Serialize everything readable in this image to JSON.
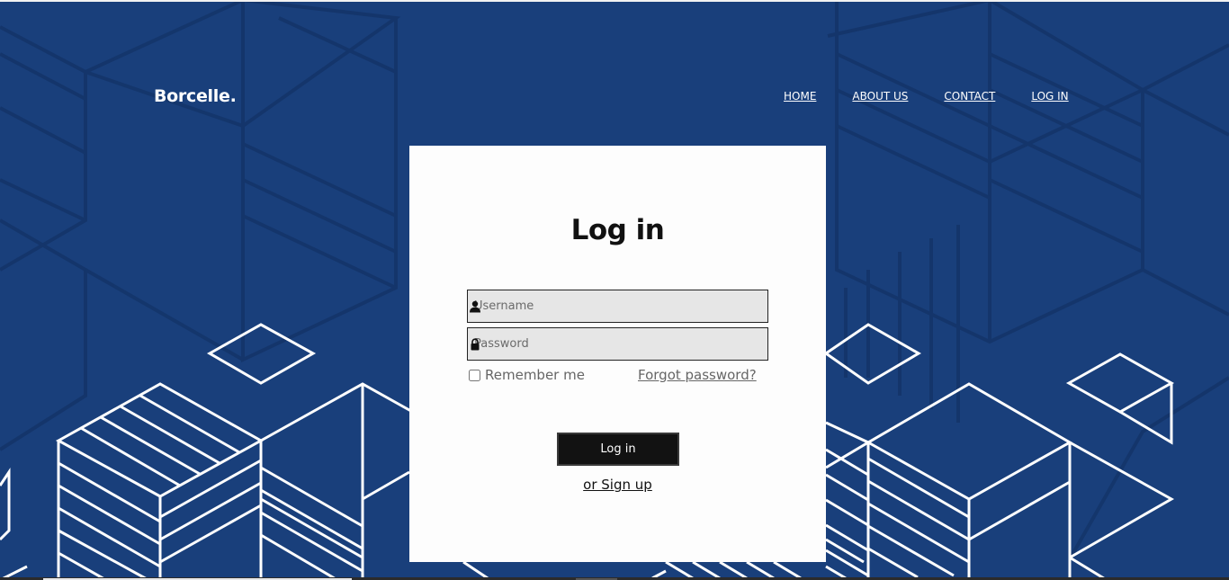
{
  "brand": {
    "logo_text": "Borcelle."
  },
  "nav": {
    "items": [
      "HOME",
      "ABOUT US",
      "CONTACT",
      "LOG IN"
    ]
  },
  "login": {
    "title": "Log in",
    "username_placeholder": "Username",
    "password_placeholder": "Password",
    "remember_label": "Remember me",
    "forgot_label": "Forgot password?",
    "submit_label": "Log in",
    "signup_label": "or Sign up"
  },
  "icons": {
    "username": "user-icon",
    "password": "lock-icon"
  },
  "colors": {
    "background": "#193f7b",
    "card": "#fdfdfd",
    "button": "#121212",
    "input_fill": "#e6e6e6",
    "pattern_lines": "#ffffff"
  }
}
